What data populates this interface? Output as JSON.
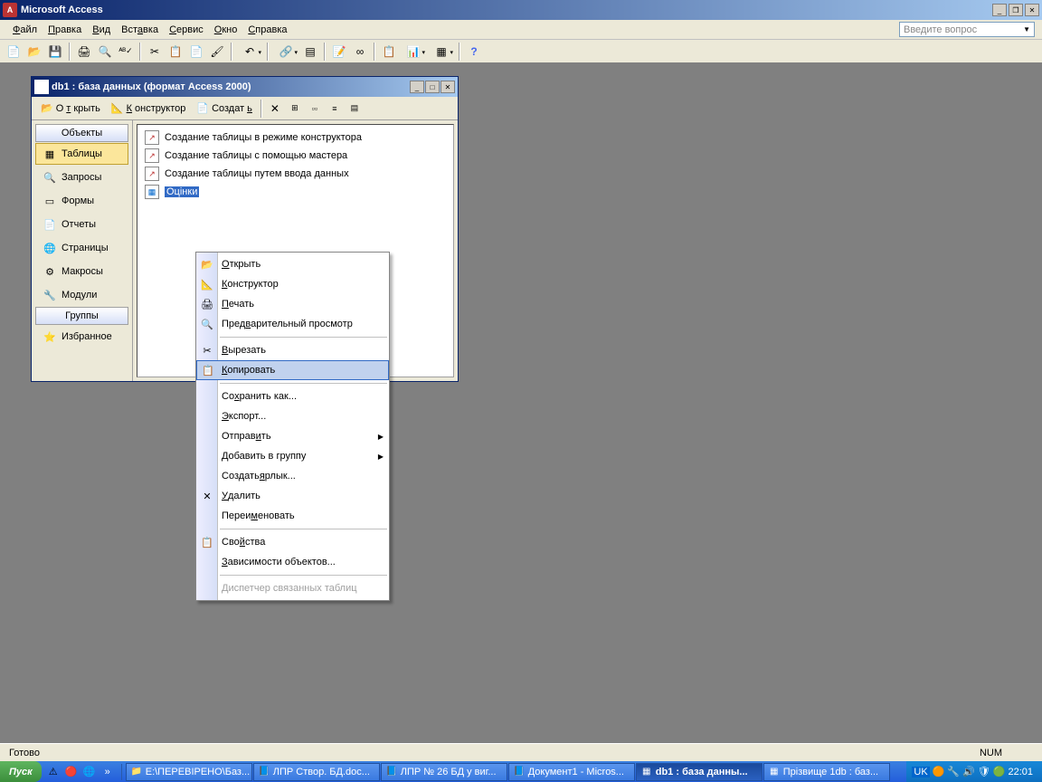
{
  "app": {
    "title": "Microsoft Access"
  },
  "menu": {
    "file": "Файл",
    "edit": "Правка",
    "view": "Вид",
    "insert": "Вставка",
    "tools": "Сервис",
    "window": "Окно",
    "help": "Справка",
    "ask": "Введите вопрос"
  },
  "dbwin": {
    "title": "db1 : база данных (формат Access 2000)",
    "toolbar": {
      "open": "Открыть",
      "design": "Конструктор",
      "new": "Создать"
    },
    "nav_header": "Объекты",
    "nav_groups_header": "Группы",
    "nav": {
      "tables": "Таблицы",
      "queries": "Запросы",
      "forms": "Формы",
      "reports": "Отчеты",
      "pages": "Страницы",
      "macros": "Макросы",
      "modules": "Модули",
      "favorites": "Избранное"
    },
    "list": {
      "create_design": "Создание таблицы в режиме конструктора",
      "create_wizard": "Создание таблицы с помощью мастера",
      "create_data": "Создание таблицы путем ввода данных",
      "table1": "Оцінки"
    }
  },
  "ctx": {
    "open": "Открыть",
    "design": "Конструктор",
    "print": "Печать",
    "preview": "Предварительный просмотр",
    "cut": "Вырезать",
    "copy": "Копировать",
    "saveas": "Сохранить как...",
    "export": "Экспорт...",
    "send": "Отправить",
    "addgroup": "Добавить в группу",
    "shortcut": "Создать ярлык...",
    "delete": "Удалить",
    "rename": "Переименовать",
    "properties": "Свойства",
    "deps": "Зависимости объектов...",
    "linked": "Диспетчер связанных таблиц"
  },
  "status": {
    "left": "Готово",
    "num": "NUM"
  },
  "taskbar": {
    "start": "Пуск",
    "items": {
      "explorer": "E:\\ПЕРЕВІРЕНО\\Баз...",
      "doc1": "ЛПР Створ. БД.doc...",
      "doc2": "ЛПР № 26 БД у виг...",
      "doc3": "Документ1 - Micros...",
      "db1": "db1 : база данны...",
      "db2": "Прізвище 1db : баз..."
    },
    "clock": "22:01",
    "lang": "UK"
  }
}
